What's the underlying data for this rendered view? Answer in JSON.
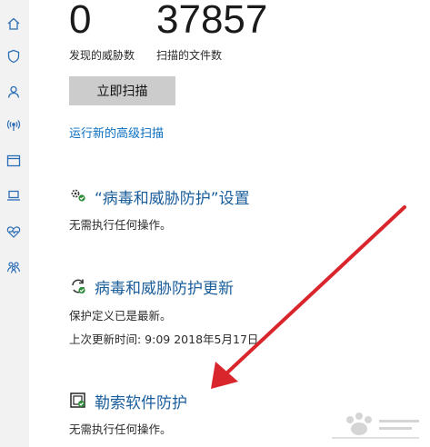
{
  "sidebar": {
    "icons": [
      "home-icon",
      "shield-icon",
      "account-icon",
      "network-icon",
      "app-browser-icon",
      "device-laptop-icon",
      "health-heart-icon",
      "family-icon"
    ]
  },
  "stats": {
    "threats_value": "0",
    "threats_label": "发现的威胁数",
    "files_value": "37857",
    "files_label": "扫描的文件数"
  },
  "scan": {
    "button_label": "立即扫描",
    "advanced_link": "运行新的高级扫描"
  },
  "sections": {
    "settings": {
      "title": "“病毒和威胁防护”设置",
      "desc": "无需执行任何操作。"
    },
    "updates": {
      "title": "病毒和威胁防护更新",
      "desc1": "保护定义已是最新。",
      "desc2": "上次更新时间: 9:09 2018年5月17日"
    },
    "ransomware": {
      "title": "勒索软件防护",
      "desc": "无需执行任何操作。"
    }
  },
  "colors": {
    "accent_link": "#0b6fc1",
    "section_title": "#1a5d9b",
    "sidebar_icon": "#2d6fb6",
    "button_bg": "#cccccc",
    "annotation_arrow": "#d9262c",
    "status_ok": "#2e8b3a"
  }
}
